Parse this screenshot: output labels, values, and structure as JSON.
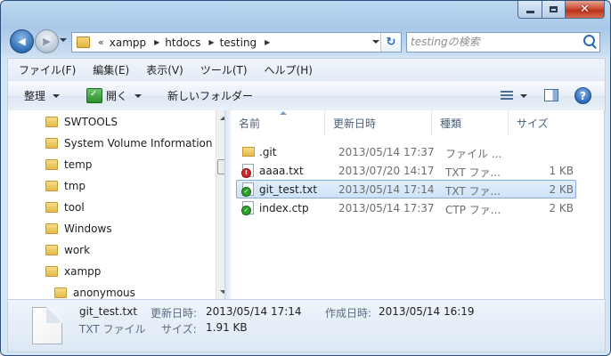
{
  "window": {
    "caption": {
      "minimize": "–",
      "maximize": "□",
      "close": "✕"
    }
  },
  "nav": {
    "back_icon": "◀",
    "forward_icon": "▶",
    "address": {
      "overflow": "«",
      "crumbs": [
        "xampp",
        "htdocs",
        "testing"
      ],
      "separator": "▶"
    },
    "refresh_icon": "↻",
    "search": {
      "placeholder": "testingの検索"
    }
  },
  "menubar": {
    "items": [
      "ファイル(F)",
      "編集(E)",
      "表示(V)",
      "ツール(T)",
      "ヘルプ(H)"
    ]
  },
  "toolbar": {
    "organize": "整理",
    "open": "開く",
    "new_folder": "新しいフォルダー",
    "help": "?"
  },
  "tree": {
    "items": [
      {
        "label": "SWTOOLS"
      },
      {
        "label": "System Volume Information"
      },
      {
        "label": "temp"
      },
      {
        "label": "tmp"
      },
      {
        "label": "tool"
      },
      {
        "label": "Windows"
      },
      {
        "label": "work"
      },
      {
        "label": "xampp"
      },
      {
        "label": "anonymous"
      }
    ]
  },
  "columns": {
    "name": "名前",
    "date": "更新日時",
    "type": "種類",
    "size": "サイズ"
  },
  "files": [
    {
      "name": ".git",
      "date": "2013/05/14 17:37",
      "type": "ファイル ...",
      "size": "",
      "icon": "folder-icon",
      "selected": false
    },
    {
      "name": "aaaa.txt",
      "date": "2013/07/20 14:17",
      "type": "TXT ファ...",
      "size": "1 KB",
      "icon": "text-file-conflict-icon",
      "selected": false
    },
    {
      "name": "git_test.txt",
      "date": "2013/05/14 17:14",
      "type": "TXT ファ...",
      "size": "2 KB",
      "icon": "text-file-ok-icon",
      "selected": true
    },
    {
      "name": "index.ctp",
      "date": "2013/05/14 17:37",
      "type": "CTP ファ...",
      "size": "2 KB",
      "icon": "ctp-file-ok-icon",
      "selected": false
    }
  ],
  "details": {
    "filename": "git_test.txt",
    "filetype": "TXT ファイル",
    "modified_label": "更新日時:",
    "modified_value": "2013/05/14 17:14",
    "created_label": "作成日時:",
    "created_value": "2013/05/14 16:19",
    "size_label": "サイズ:",
    "size_value": "1.91 KB"
  },
  "colors": {
    "selection": "#cfe2f8",
    "selection_border": "#84acdd",
    "conflict_badge": "#d42828",
    "ok_badge": "#2ea02c"
  }
}
